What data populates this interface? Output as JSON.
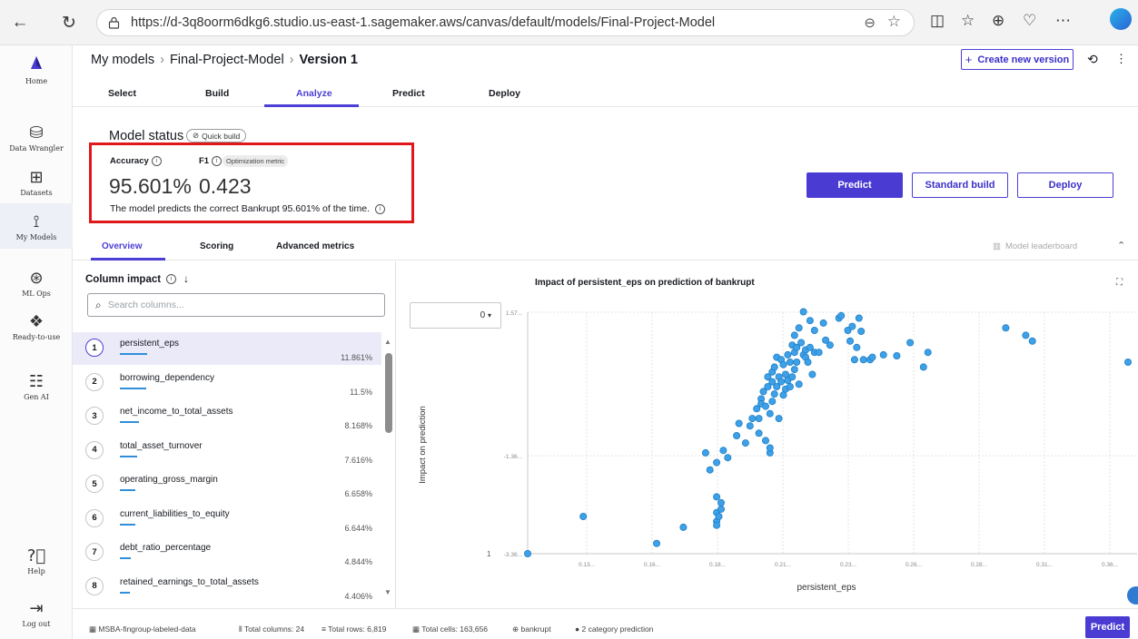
{
  "browser": {
    "url": "https://d-3q8oorm6dkg6.studio.us-east-1.sagemaker.aws/canvas/default/models/Final-Project-Model"
  },
  "leftnav": [
    {
      "label": "Home",
      "icon": "home-icon"
    },
    {
      "label": "Data Wrangler",
      "icon": "data-wrangler-icon"
    },
    {
      "label": "Datasets",
      "icon": "datasets-icon"
    },
    {
      "label": "My Models",
      "icon": "my-models-icon"
    },
    {
      "label": "ML Ops",
      "icon": "ml-ops-icon"
    },
    {
      "label": "Ready-to-use",
      "icon": "ready-to-use-icon"
    },
    {
      "label": "Gen AI",
      "icon": "gen-ai-icon"
    },
    {
      "label": "Help",
      "icon": "help-icon"
    },
    {
      "label": "Log out",
      "icon": "logout-icon"
    }
  ],
  "header": {
    "crumb1": "My models",
    "crumb2": "Final-Project-Model",
    "crumb3": "Version 1",
    "create_version": "Create new version"
  },
  "tabs": [
    "Select",
    "Build",
    "Analyze",
    "Predict",
    "Deploy"
  ],
  "status": {
    "title": "Model status",
    "chip": "Quick build",
    "accuracy_label": "Accuracy",
    "f1_label": "F1",
    "opt_badge": "Optimization metric",
    "accuracy_value": "95.601%",
    "f1_value": "0.423",
    "description": "The model predicts the correct Bankrupt 95.601% of the time."
  },
  "actions": {
    "predict": "Predict",
    "standard_build": "Standard build",
    "deploy": "Deploy"
  },
  "subtabs": [
    "Overview",
    "Scoring",
    "Advanced metrics"
  ],
  "leaderboard": "Model leaderboard",
  "column_impact": {
    "title": "Column impact",
    "search_placeholder": "Search columns...",
    "rows": [
      {
        "rank": "1",
        "name": "persistent_eps",
        "pct": "11.861%",
        "value": 11.861
      },
      {
        "rank": "2",
        "name": "borrowing_dependency",
        "pct": "11.5%",
        "value": 11.5
      },
      {
        "rank": "3",
        "name": "net_income_to_total_assets",
        "pct": "8.168%",
        "value": 8.168
      },
      {
        "rank": "4",
        "name": "total_asset_turnover",
        "pct": "7.616%",
        "value": 7.616
      },
      {
        "rank": "5",
        "name": "operating_gross_margin",
        "pct": "6.658%",
        "value": 6.658
      },
      {
        "rank": "6",
        "name": "current_liabilities_to_equity",
        "pct": "6.644%",
        "value": 6.644
      },
      {
        "rank": "7",
        "name": "debt_ratio_percentage",
        "pct": "4.844%",
        "value": 4.844
      },
      {
        "rank": "8",
        "name": "retained_earnings_to_total_assets",
        "pct": "4.406%",
        "value": 4.406
      }
    ]
  },
  "chart_select": "0",
  "chart_data": {
    "type": "scatter",
    "title": "Impact of persistent_eps on prediction of bankrupt",
    "xlabel": "persistent_eps",
    "ylabel": "Impact on prediction",
    "x_ticks": [
      "0.13...",
      "0.16...",
      "0.18...",
      "0.21...",
      "0.23...",
      "0.26...",
      "0.28...",
      "0.31...",
      "0.36..."
    ],
    "y_ticks": [
      "1.57...",
      "-1.36...",
      "-3.36..."
    ],
    "y_tick_values": [
      1.57,
      -1.36,
      -3.36
    ],
    "origin_label": "1",
    "xlim": [
      0.105,
      0.375
    ],
    "ylim": [
      -3.36,
      1.57
    ],
    "points": [
      [
        0.105,
        -3.36
      ],
      [
        0.13,
        -2.6
      ],
      [
        0.163,
        -3.15
      ],
      [
        0.175,
        -2.82
      ],
      [
        0.185,
        -1.3
      ],
      [
        0.187,
        -1.65
      ],
      [
        0.19,
        -1.5
      ],
      [
        0.19,
        -2.2
      ],
      [
        0.193,
        -1.25
      ],
      [
        0.195,
        -1.4
      ],
      [
        0.19,
        -2.52
      ],
      [
        0.19,
        -2.7
      ],
      [
        0.19,
        -2.78
      ],
      [
        0.191,
        -2.6
      ],
      [
        0.192,
        -2.45
      ],
      [
        0.192,
        -2.32
      ],
      [
        0.199,
        -0.95
      ],
      [
        0.2,
        -0.7
      ],
      [
        0.203,
        -1.1
      ],
      [
        0.205,
        -0.75
      ],
      [
        0.206,
        -0.6
      ],
      [
        0.208,
        -0.4
      ],
      [
        0.209,
        -0.6
      ],
      [
        0.209,
        -0.9
      ],
      [
        0.21,
        -0.2
      ],
      [
        0.21,
        -0.3
      ],
      [
        0.211,
        -0.05
      ],
      [
        0.212,
        -0.35
      ],
      [
        0.212,
        -1.05
      ],
      [
        0.213,
        0.05
      ],
      [
        0.213,
        0.25
      ],
      [
        0.214,
        -1.3
      ],
      [
        0.214,
        -1.2
      ],
      [
        0.214,
        -0.5
      ],
      [
        0.215,
        0.15
      ],
      [
        0.215,
        -0.25
      ],
      [
        0.215,
        0.35
      ],
      [
        0.216,
        0.45
      ],
      [
        0.216,
        -0.1
      ],
      [
        0.217,
        0.65
      ],
      [
        0.217,
        0.05
      ],
      [
        0.218,
        -0.6
      ],
      [
        0.218,
        0.25
      ],
      [
        0.219,
        0.15
      ],
      [
        0.219,
        0.6
      ],
      [
        0.22,
        -0.12
      ],
      [
        0.22,
        0.5
      ],
      [
        0.221,
        0.3
      ],
      [
        0.221,
        0.0
      ],
      [
        0.222,
        0.18
      ],
      [
        0.222,
        0.7
      ],
      [
        0.223,
        0.05
      ],
      [
        0.223,
        0.55
      ],
      [
        0.224,
        0.25
      ],
      [
        0.224,
        0.9
      ],
      [
        0.225,
        0.75
      ],
      [
        0.225,
        1.1
      ],
      [
        0.225,
        0.4
      ],
      [
        0.226,
        0.85
      ],
      [
        0.226,
        0.55
      ],
      [
        0.227,
        1.25
      ],
      [
        0.227,
        0.1
      ],
      [
        0.228,
        0.95
      ],
      [
        0.229,
        0.7
      ],
      [
        0.229,
        1.58
      ],
      [
        0.23,
        0.8
      ],
      [
        0.23,
        0.65
      ],
      [
        0.231,
        0.55
      ],
      [
        0.232,
        0.85
      ],
      [
        0.232,
        1.4
      ],
      [
        0.233,
        0.3
      ],
      [
        0.234,
        0.75
      ],
      [
        0.234,
        1.2
      ],
      [
        0.236,
        0.75
      ],
      [
        0.238,
        1.35
      ],
      [
        0.239,
        1.0
      ],
      [
        0.241,
        0.9
      ],
      [
        0.245,
        1.45
      ],
      [
        0.246,
        1.5
      ],
      [
        0.249,
        1.2
      ],
      [
        0.25,
        0.98
      ],
      [
        0.251,
        1.28
      ],
      [
        0.252,
        0.6
      ],
      [
        0.253,
        0.85
      ],
      [
        0.254,
        1.45
      ],
      [
        0.255,
        1.18
      ],
      [
        0.256,
        0.6
      ],
      [
        0.259,
        0.6
      ],
      [
        0.26,
        0.65
      ],
      [
        0.265,
        0.7
      ],
      [
        0.271,
        0.68
      ],
      [
        0.277,
        0.95
      ],
      [
        0.283,
        0.45
      ],
      [
        0.285,
        0.75
      ],
      [
        0.32,
        1.25
      ],
      [
        0.329,
        1.1
      ],
      [
        0.332,
        0.98
      ],
      [
        0.375,
        0.55
      ]
    ]
  },
  "footer": {
    "dataset": "MSBA-fingroup-labeled-data",
    "columns": "Total columns: 24",
    "rows": "Total rows: 6,819",
    "cells": "Total cells: 163,656",
    "target": "bankrupt",
    "prediction_type": "2 category prediction",
    "predict": "Predict"
  },
  "colors": {
    "accent": "#4a3bd3",
    "highlight_box": "#e0181b",
    "point": "#3ea0e6"
  }
}
